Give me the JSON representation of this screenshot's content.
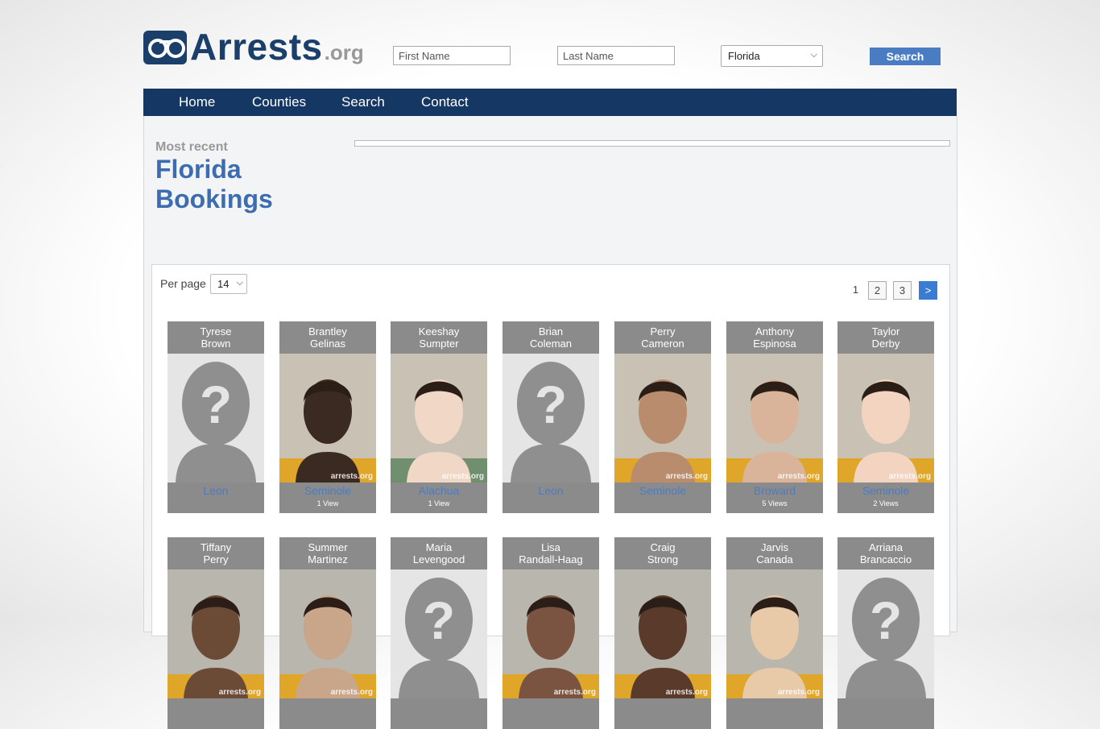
{
  "logo": {
    "text": "Arrests",
    "suffix": ".org"
  },
  "search": {
    "first_placeholder": "First Name",
    "last_placeholder": "Last Name",
    "state": "Florida",
    "button": "Search"
  },
  "nav": [
    "Home",
    "Counties",
    "Search",
    "Contact"
  ],
  "heading": {
    "kicker": "Most recent",
    "line1": "Florida",
    "line2": "Bookings"
  },
  "list": {
    "per_page_label": "Per page",
    "per_page": "14",
    "pages": [
      "1",
      "2",
      "3",
      ">"
    ]
  },
  "watermark": "arrests.org",
  "bookings": [
    {
      "first": "Tyrese",
      "last": "Brown",
      "county": "Leon",
      "views": "",
      "photo": "placeholder"
    },
    {
      "first": "Brantley",
      "last": "Gelinas",
      "county": "Seminole",
      "views": "1 View",
      "photo": "photo"
    },
    {
      "first": "Keeshay",
      "last": "Sumpter",
      "county": "Alachua",
      "views": "1 View",
      "photo": "photo"
    },
    {
      "first": "Brian",
      "last": "Coleman",
      "county": "Leon",
      "views": "",
      "photo": "placeholder"
    },
    {
      "first": "Perry",
      "last": "Cameron",
      "county": "Seminole",
      "views": "",
      "photo": "photo"
    },
    {
      "first": "Anthony",
      "last": "Espinosa",
      "county": "Broward",
      "views": "5 Views",
      "photo": "photo"
    },
    {
      "first": "Taylor",
      "last": "Derby",
      "county": "Seminole",
      "views": "2 Views",
      "photo": "photo"
    },
    {
      "first": "Tiffany",
      "last": "Perry",
      "county": "",
      "views": "",
      "photo": "photo"
    },
    {
      "first": "Summer",
      "last": "Martinez",
      "county": "",
      "views": "",
      "photo": "photo"
    },
    {
      "first": "Maria",
      "last": "Levengood",
      "county": "",
      "views": "",
      "photo": "placeholder"
    },
    {
      "first": "Lisa",
      "last": "Randall-Haag",
      "county": "",
      "views": "",
      "photo": "photo"
    },
    {
      "first": "Craig",
      "last": "Strong",
      "county": "",
      "views": "",
      "photo": "photo"
    },
    {
      "first": "Jarvis",
      "last": "Canada",
      "county": "",
      "views": "",
      "photo": "photo"
    },
    {
      "first": "Arriana",
      "last": "Brancaccio",
      "county": "",
      "views": "",
      "photo": "placeholder"
    }
  ]
}
